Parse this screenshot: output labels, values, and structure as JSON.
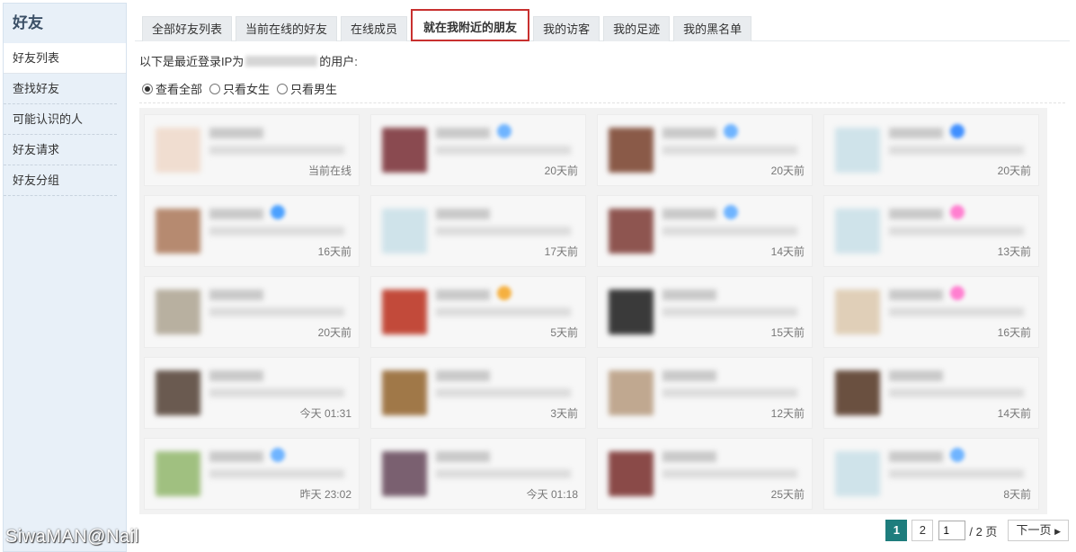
{
  "sidebar": {
    "title": "好友",
    "items": [
      {
        "label": "好友列表",
        "active": true
      },
      {
        "label": "查找好友"
      },
      {
        "label": "可能认识的人"
      },
      {
        "label": "好友请求"
      },
      {
        "label": "好友分组"
      }
    ]
  },
  "tabs": [
    {
      "label": "全部好友列表"
    },
    {
      "label": "当前在线的好友"
    },
    {
      "label": "在线成员"
    },
    {
      "label": "就在我附近的朋友",
      "active": true
    },
    {
      "label": "我的访客"
    },
    {
      "label": "我的足迹"
    },
    {
      "label": "我的黑名单"
    }
  ],
  "ip_line": {
    "prefix": "以下是最近登录IP为",
    "suffix": "的用户:"
  },
  "filter": {
    "options": [
      {
        "label": "查看全部",
        "checked": true
      },
      {
        "label": "只看女生"
      },
      {
        "label": "只看男生"
      }
    ]
  },
  "cards": [
    {
      "time": "当前在线",
      "avatar_color": "#f0ddd0",
      "badge": ""
    },
    {
      "time": "20天前",
      "avatar_color": "#8a4a50",
      "badge": "#6fb4ff"
    },
    {
      "time": "20天前",
      "avatar_color": "#8a5a48",
      "badge": "#6fb4ff"
    },
    {
      "time": "20天前",
      "avatar_color": "#cfe3ea",
      "badge": "#3f8fff"
    },
    {
      "time": "16天前",
      "avatar_color": "#b68a70",
      "badge": "#4aa0ff"
    },
    {
      "time": "17天前",
      "avatar_color": "#cfe3ea",
      "badge": ""
    },
    {
      "time": "14天前",
      "avatar_color": "#8e5550",
      "badge": "#6fb4ff"
    },
    {
      "time": "13天前",
      "avatar_color": "#cfe3ea",
      "badge": "#ff7fd0"
    },
    {
      "time": "20天前",
      "avatar_color": "#b8b0a0",
      "badge": ""
    },
    {
      "time": "5天前",
      "avatar_color": "#c24a3a",
      "badge": "#f5b040"
    },
    {
      "time": "15天前",
      "avatar_color": "#3a3a3a",
      "badge": ""
    },
    {
      "time": "16天前",
      "avatar_color": "#e0cfb8",
      "badge": "#ff7fd0"
    },
    {
      "time": "今天 01:31",
      "avatar_color": "#6a5a50",
      "badge": ""
    },
    {
      "time": "3天前",
      "avatar_color": "#a07848",
      "badge": ""
    },
    {
      "time": "12天前",
      "avatar_color": "#c0a890",
      "badge": ""
    },
    {
      "time": "14天前",
      "avatar_color": "#6a5040",
      "badge": ""
    },
    {
      "time": "昨天 23:02",
      "avatar_color": "#a0c080",
      "badge": "#6fb4ff"
    },
    {
      "time": "今天 01:18",
      "avatar_color": "#7a6070",
      "badge": ""
    },
    {
      "time": "25天前",
      "avatar_color": "#8a4a48",
      "badge": ""
    },
    {
      "time": "8天前",
      "avatar_color": "#cfe3ea",
      "badge": "#6fb4ff"
    }
  ],
  "pager": {
    "pages": [
      "1",
      "2"
    ],
    "current": "1",
    "input_value": "1",
    "total": "/ 2 页",
    "next_label": "下一页"
  },
  "watermark": "SiwaMAN@Nail"
}
